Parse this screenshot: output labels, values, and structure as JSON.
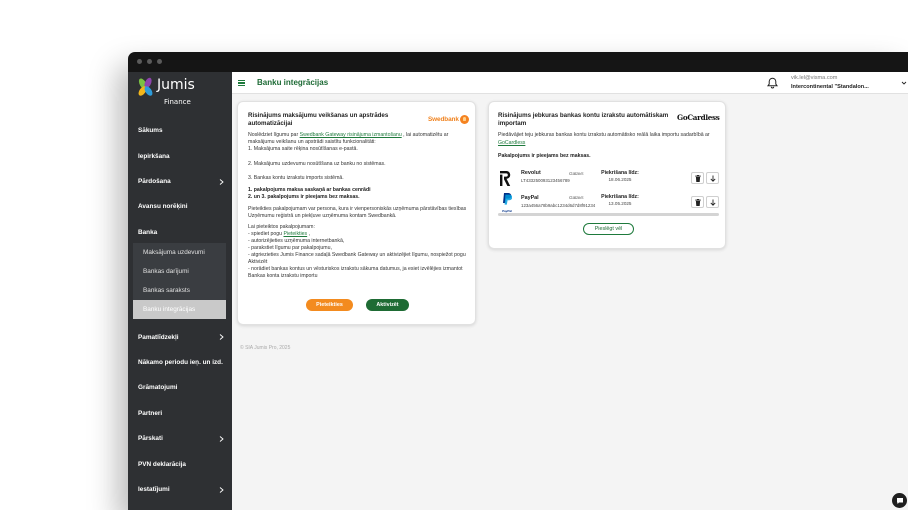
{
  "colors": {
    "accent_green": "#1e7a3c",
    "brand_orange": "#f0821e",
    "sidebar_bg": "#2e3033",
    "active_item_bg": "#c9c9c9"
  },
  "brand": {
    "name": "Jumis",
    "sub": "Finance",
    "logo_icon": "jumis-leaf-logo"
  },
  "header": {
    "menu_icon": "hamburger-icon",
    "title": "Banku integrācijas",
    "notifications_icon": "bell-icon",
    "user_email": "vik.lel@visma.com",
    "company": "Intercontinental \"Standalon..."
  },
  "sidebar": {
    "items": [
      {
        "label": "Sākums"
      },
      {
        "label": "Iepirkšana"
      },
      {
        "label": "Pārdošana"
      },
      {
        "label": "Avansu norēķini"
      },
      {
        "label": "Banka"
      },
      {
        "label": "Pamatlīdzekļi"
      },
      {
        "label": "Nākamo periodu ieņ. un izd."
      },
      {
        "label": "Grāmatojumi"
      },
      {
        "label": "Partneri"
      },
      {
        "label": "Pārskati"
      },
      {
        "label": "PVN deklarācija"
      },
      {
        "label": "Iestatījumi"
      }
    ],
    "bank_submenu": [
      {
        "label": "Maksājuma uzdevumi"
      },
      {
        "label": "Bankas darījumi"
      },
      {
        "label": "Bankas saraksts"
      },
      {
        "label": "Banku integrācijas",
        "active": true
      }
    ]
  },
  "swedbank": {
    "title_lines": [
      "Risinājums maksājumu veikšanas un apstrādes",
      "automatizācijai"
    ],
    "logo_text": "Swedbank",
    "intro": {
      "before": "Noslēdziet līgumu par ",
      "link": "Swedbank Gateway risinājuma izmantošanu",
      "after": " , lai automatizētu ar maksājumu veikšanu un apstrādi saistītu funkcionalitāti:"
    },
    "features": [
      "1. Maksājuma saite rēķina nosūtīšanas e-pastā.",
      "2. Maksājumu uzdevumu nosūtīšana uz banku no sistēmas.",
      "3. Bankas kontu izrakstu imports sistēmā."
    ],
    "pricing": [
      "1. pakalpojums maksa saskaņā ar bankas cenrādi",
      "2. un 3. pakalpojums ir pieejams bez maksas."
    ],
    "eligibility": "Pieteikties pakalpojumam var persona, kura ir vienpersoniskās uzņēmuma pārstāvības tiesības Uzņēmumu reģistrā un piekļuve uzņēmuma kontam Swedbankā.",
    "how_to_title": "Lai pieteiktos pakalpojumam:",
    "how_to_first": {
      "before": "- spiediet pogu ",
      "link": "Pieteikties",
      "after": " ,"
    },
    "how_to_steps": [
      "- autorizējieties uzņēmuma internetbankā,",
      "- parakstiet līgumu par pakalpojumu,",
      "- atgriezieties Jumis Finance sadaļā Swedbank Gateway un aktivizējiet līgumu, nospiežot pogu Aktivizēt",
      "- norādiet bankas kontus un vēsturiskos izrakstu sākuma datumus, ja esiet izvēlējies izmantot Bankas konta izrakstu importu"
    ],
    "apply_button": "Pieteikties",
    "activate_button": "Aktivizēt"
  },
  "gocardless": {
    "title_lines": [
      "Risinājums jebkuras bankas kontu izrakstu automātiskam",
      "importam"
    ],
    "logo_text": "GoCardless",
    "intro": {
      "before": "Piedāvājiet teju jebkuras bankas kontu izrakstu automātisko reālā laika importu sadarbībā ar ",
      "link": "GoCardless"
    },
    "free_text": "Pakalpojums ir pieejams bez maksas.",
    "connections": [
      {
        "logo": "revolut-logo",
        "name": "Revolut",
        "account": "LT433250093123456789",
        "status": "Gatavs",
        "consent_label": "Piekrišana līdz:",
        "consent_date": "18.06.2025"
      },
      {
        "logo": "paypal-logo",
        "logo_text": "PayPal",
        "name": "PayPal",
        "account": "123a456a78b9abc1234d6d7d8f91234",
        "status": "Gatavs",
        "consent_label": "Piekrišana līdz:",
        "consent_date": "13.05.2025"
      }
    ],
    "row_actions": [
      "trash-icon",
      "arrow-down-icon"
    ],
    "add_button": "Pieslēgt vēl"
  },
  "footer": {
    "copyright": "© SIA Jumis Pro, 2025"
  },
  "chat_icon": "chat-bubble-icon"
}
